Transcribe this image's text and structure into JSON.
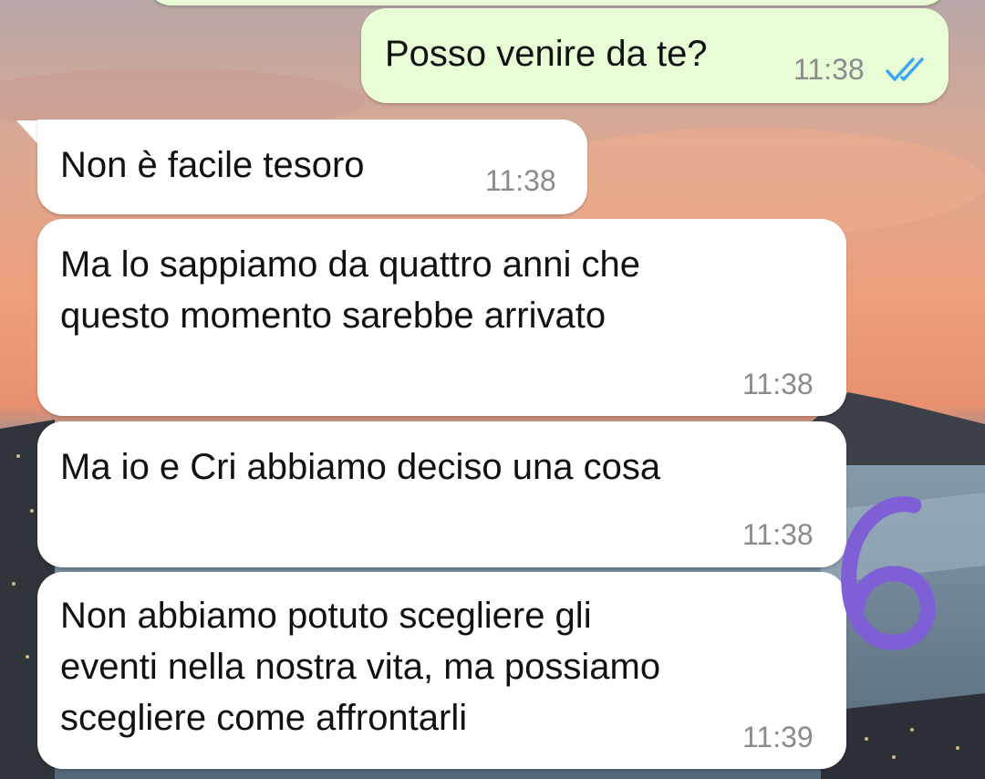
{
  "colors": {
    "outgoing_bubble": "#e8fdd6",
    "incoming_bubble": "#ffffff",
    "read_ticks": "#3aa8f0",
    "timestamp": "#8b8b8b",
    "doodle": "#7f5fd6"
  },
  "messages": [
    {
      "direction": "outgoing",
      "text": "Posso venire da te?",
      "time": "11:38",
      "status": "read",
      "status_icon": "double-check-icon"
    },
    {
      "direction": "incoming",
      "text": "Non è facile tesoro",
      "time": "11:38"
    },
    {
      "direction": "incoming",
      "text": "Ma lo sappiamo da quattro anni che\nquesto momento sarebbe arrivato",
      "time": "11:38"
    },
    {
      "direction": "incoming",
      "text": "Ma io e Cri abbiamo deciso una cosa",
      "time": "11:38"
    },
    {
      "direction": "incoming",
      "text": "Non abbiamo potuto scegliere gli\neventi nella nostra vita, ma possiamo\nscegliere come affrontarli",
      "time": "11:39"
    }
  ],
  "annotation": {
    "text": "6",
    "icon": "handwritten-six"
  }
}
